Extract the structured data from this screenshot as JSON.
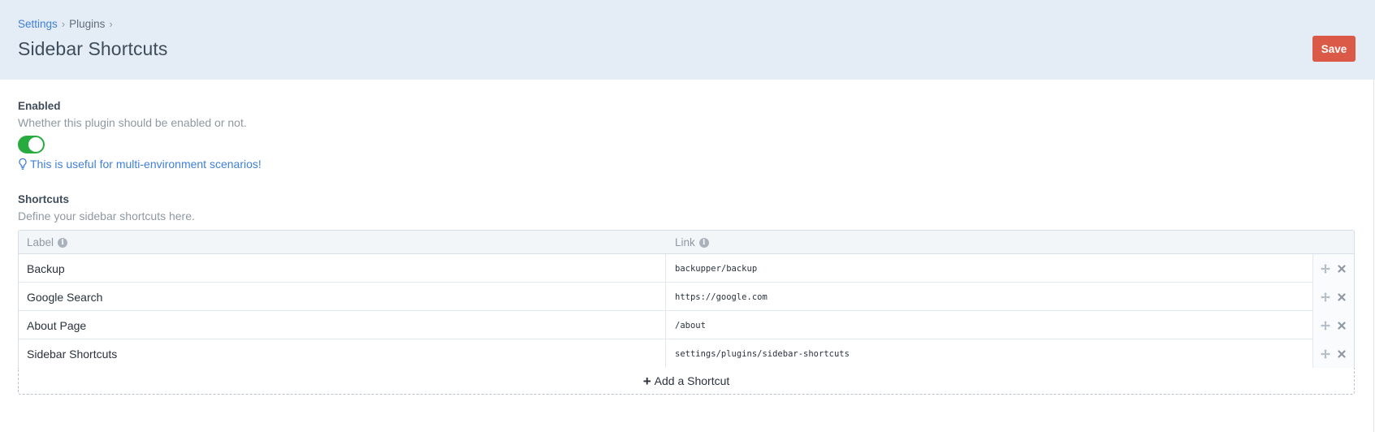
{
  "header": {
    "breadcrumbs": [
      "Settings",
      "Plugins"
    ],
    "separator": "›",
    "title": "Sidebar Shortcuts",
    "save_label": "Save"
  },
  "enabled_field": {
    "label": "Enabled",
    "instructions": "Whether this plugin should be enabled or not.",
    "toggle_on": true,
    "tip": "This is useful for multi-environment scenarios!"
  },
  "shortcuts_field": {
    "label": "Shortcuts",
    "instructions": "Define your sidebar shortcuts here.",
    "columns": [
      "Label",
      "Link"
    ],
    "rows": [
      {
        "label": "Backup",
        "link": "backupper/backup"
      },
      {
        "label": "Google Search",
        "link": "https://google.com"
      },
      {
        "label": "About Page",
        "link": "/about"
      },
      {
        "label": "Sidebar Shortcuts",
        "link": "settings/plugins/sidebar-shortcuts"
      }
    ],
    "add_label": "Add a Shortcut"
  },
  "icons": {
    "info": "info-icon",
    "bulb": "lightbulb-icon",
    "move": "move-icon",
    "delete": "delete-icon",
    "add": "plus-icon"
  },
  "colors": {
    "header_bg": "#e4edf6",
    "save_button": "#da5a47",
    "toggle_on": "#27ab3f",
    "link": "#3f80d8"
  }
}
